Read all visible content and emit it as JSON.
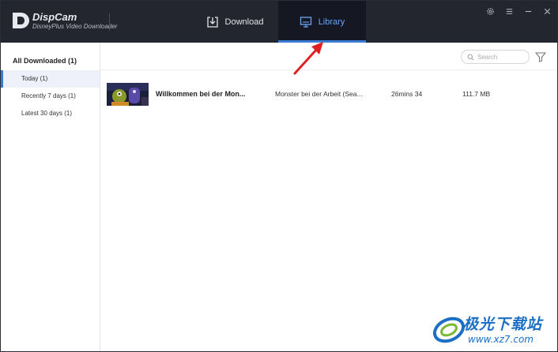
{
  "app": {
    "name": "DispCam",
    "subtitle": "DisneyPlus Video Downloader"
  },
  "tabs": {
    "download": {
      "label": "Download",
      "icon": "download-icon"
    },
    "library": {
      "label": "Library",
      "icon": "monitor-icon",
      "active": true
    }
  },
  "window_controls": [
    "settings-icon",
    "menu-icon",
    "minimize-icon",
    "close-icon"
  ],
  "sidebar": {
    "header": "All Downloaded (1)",
    "items": [
      {
        "label": "Today (1)",
        "active": true
      },
      {
        "label": "Recently 7 days (1)",
        "active": false
      },
      {
        "label": "Latest 30 days (1)",
        "active": false
      }
    ]
  },
  "search": {
    "placeholder": "Search"
  },
  "downloads": [
    {
      "title": "Willkommen bei der Mon...",
      "series": "Monster bei der Arbeit (Sea...",
      "duration": "26mins 34",
      "size": "111.7 MB"
    }
  ],
  "watermark": {
    "text": "极光下载站",
    "url": "www.xz7.com"
  },
  "colors": {
    "titlebar": "#23252f",
    "accent": "#3a7bd5",
    "annotation_arrow": "#e02020"
  }
}
